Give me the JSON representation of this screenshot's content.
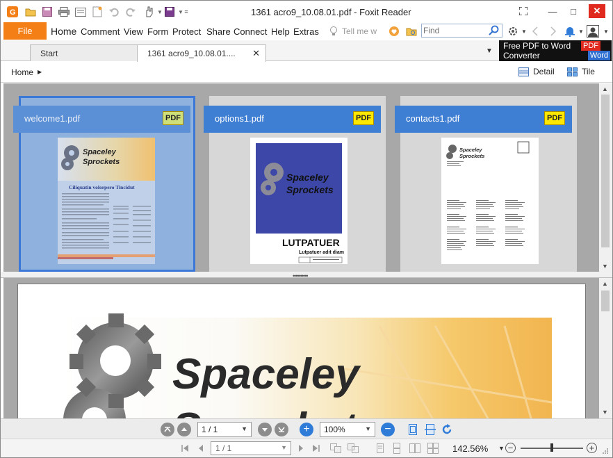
{
  "window": {
    "title": "1361 acro9_10.08.01.pdf - Foxit Reader",
    "minimize": "—",
    "restore": "□",
    "close": "✕"
  },
  "menu": {
    "file": "File",
    "items": [
      "Home",
      "Comment",
      "View",
      "Form",
      "Protect",
      "Share",
      "Connect",
      "Help",
      "Extras"
    ],
    "tell_me": "Tell me w",
    "find_placeholder": "Find"
  },
  "tabs": {
    "start": "Start",
    "document": "1361 acro9_10.08.01....",
    "promo_line1": "Free PDF to Word",
    "promo_line2": "Converter",
    "promo_pdf": "PDF",
    "promo_word": "Word"
  },
  "breadcrumb": {
    "home": "Home",
    "view_detail": "Detail",
    "view_tile": "Tile"
  },
  "portfolio": {
    "files": [
      {
        "name": "welcome1.pdf",
        "badge": "PDF",
        "selected": true
      },
      {
        "name": "options1.pdf",
        "badge": "PDF",
        "selected": false
      },
      {
        "name": "contacts1.pdf",
        "badge": "PDF",
        "selected": false
      }
    ],
    "thumb_welcome": {
      "brand_line1": "Spaceley",
      "brand_line2": "Sprockets",
      "heading": "Ciliquatin volorpero Tincidut"
    },
    "thumb_options": {
      "brand_line1": "Spaceley",
      "brand_line2": "Sprockets",
      "heading": "LUTPATUER",
      "subheading": "Lutpatuer adit diam"
    },
    "thumb_contacts": {
      "brand_line1": "Spaceley",
      "brand_line2": "Sprockets"
    }
  },
  "document": {
    "brand_line1": "Spaceley",
    "brand_line2": "Sprockets"
  },
  "navbar": {
    "page_value": "1 / 1",
    "zoom_value": "100%"
  },
  "statusbar": {
    "page_value": "1 / 1",
    "zoom_percent": "142.56%",
    "zoom_fraction": 0.5
  },
  "colors": {
    "file_button": "#f57f17",
    "accent_blue": "#3f7fd3",
    "pdf_badge": "#ffe800",
    "close_red": "#e02a20"
  }
}
